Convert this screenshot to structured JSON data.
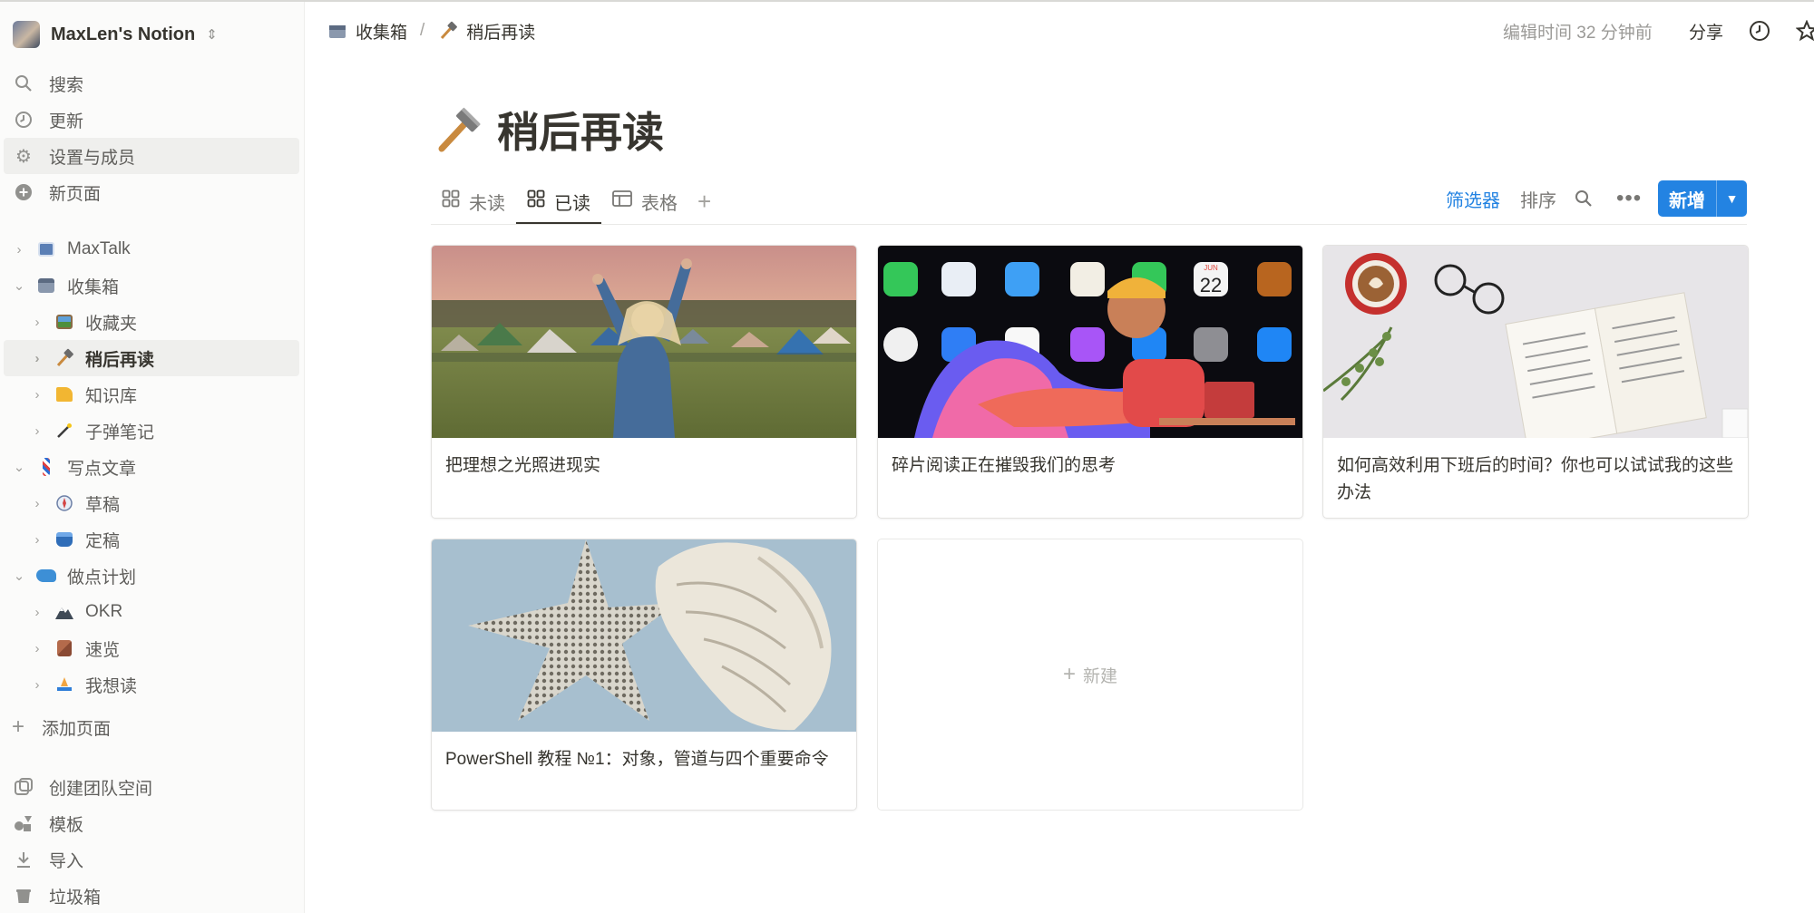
{
  "workspace": {
    "name": "MaxLen's Notion"
  },
  "sidebar": {
    "nav": [
      {
        "label": "搜索",
        "icon": "search-icon"
      },
      {
        "label": "更新",
        "icon": "clock-icon"
      },
      {
        "label": "设置与成员",
        "icon": "gear-icon"
      },
      {
        "label": "新页面",
        "icon": "plus-circle-icon"
      }
    ],
    "tree": [
      {
        "label": "MaxTalk",
        "icon": "book-emoji"
      },
      {
        "label": "收集箱",
        "icon": "inbox-emoji"
      },
      {
        "label": "收藏夹",
        "icon": "picture-emoji"
      },
      {
        "label": "稍后再读",
        "icon": "hammer-emoji"
      },
      {
        "label": "知识库",
        "icon": "cheese-emoji"
      },
      {
        "label": "子弹笔记",
        "icon": "magic-wand-emoji"
      },
      {
        "label": "写点文章",
        "icon": "barber-pole-emoji"
      },
      {
        "label": "草稿",
        "icon": "compass-emoji"
      },
      {
        "label": "定稿",
        "icon": "drum-emoji"
      },
      {
        "label": "做点计划",
        "icon": "whale-emoji"
      },
      {
        "label": "OKR",
        "icon": "mountain-emoji"
      },
      {
        "label": "速览",
        "icon": "box-emoji"
      },
      {
        "label": "我想读",
        "icon": "ship-emoji"
      }
    ],
    "add_page": "添加页面",
    "footer": [
      {
        "label": "创建团队空间",
        "icon": "team-icon"
      },
      {
        "label": "模板",
        "icon": "shapes-icon"
      },
      {
        "label": "导入",
        "icon": "download-icon"
      },
      {
        "label": "垃圾箱",
        "icon": "trash-icon"
      }
    ]
  },
  "topbar": {
    "breadcrumbs": [
      "收集箱",
      "稍后再读"
    ],
    "edited": "编辑时间 32 分钟前",
    "share": "分享"
  },
  "page": {
    "title": "稍后再读",
    "tabs": [
      "未读",
      "已读",
      "表格"
    ],
    "active_tab": "已读",
    "filter": "筛选器",
    "sort": "排序",
    "new": "新增"
  },
  "cards": [
    {
      "title": "把理想之光照进现实",
      "cover": "concert-crowd"
    },
    {
      "title": "碎片阅读正在摧毁我们的思考",
      "cover": "app-icons",
      "calendar_month": "JUN",
      "calendar_day": "22"
    },
    {
      "title": "如何高效利用下班后的时间？你也可以试试我的这些办法",
      "cover": "coffee-book"
    },
    {
      "title": "PowerShell 教程 №1：对象，管道与四个重要命令",
      "cover": "starfish-shell"
    }
  ],
  "new_card": "新建",
  "colors": {
    "accent": "#2383e2",
    "text": "#37352f",
    "sidebar_bg": "#fbfbfa"
  }
}
